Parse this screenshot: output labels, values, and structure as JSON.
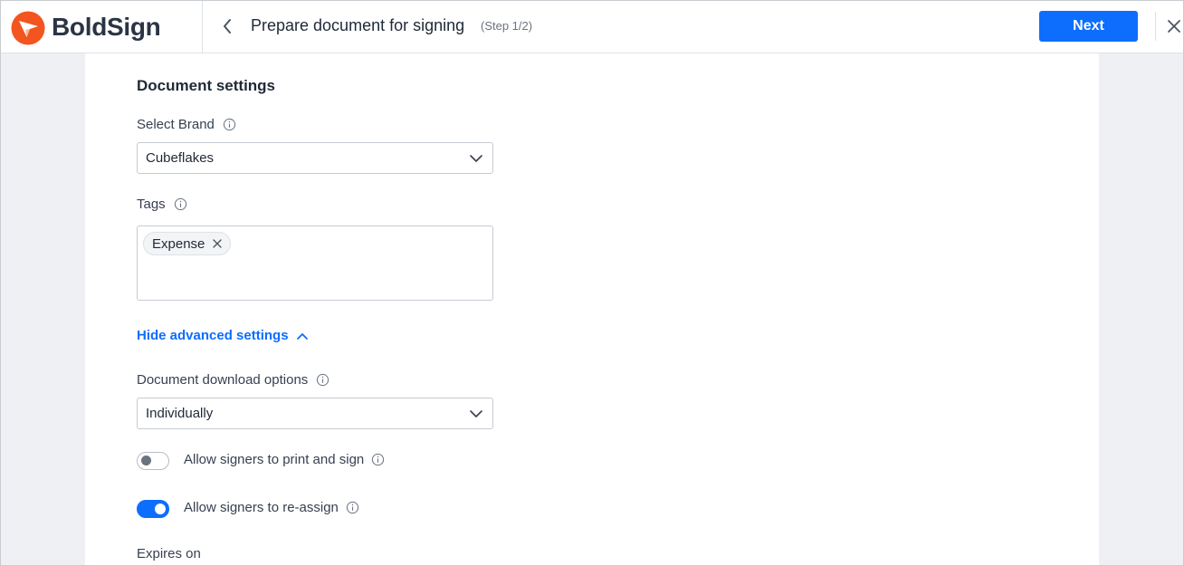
{
  "brand": {
    "name": "BoldSign",
    "logo_icon": "boldsign-logo-icon",
    "logo_color": "#f2551f"
  },
  "header": {
    "back_icon": "chevron-left-icon",
    "title": "Prepare document for signing",
    "step": "(Step 1/2)",
    "next_label": "Next",
    "close_icon": "close-icon"
  },
  "colors": {
    "accent": "#0d6efd",
    "arrow": "#f2551f"
  },
  "settings": {
    "section_title": "Document settings",
    "brand_label": "Select Brand",
    "brand_value": "Cubeflakes",
    "tags_label": "Tags",
    "tags": [
      {
        "label": "Expense"
      }
    ],
    "advanced_link": "Hide advanced settings",
    "download_label": "Document download options",
    "download_value": "Individually",
    "print_sign_label": "Allow signers to print and sign",
    "print_sign_enabled": false,
    "reassign_label": "Allow signers to re-assign",
    "reassign_enabled": true,
    "expires_label": "Expires on"
  }
}
